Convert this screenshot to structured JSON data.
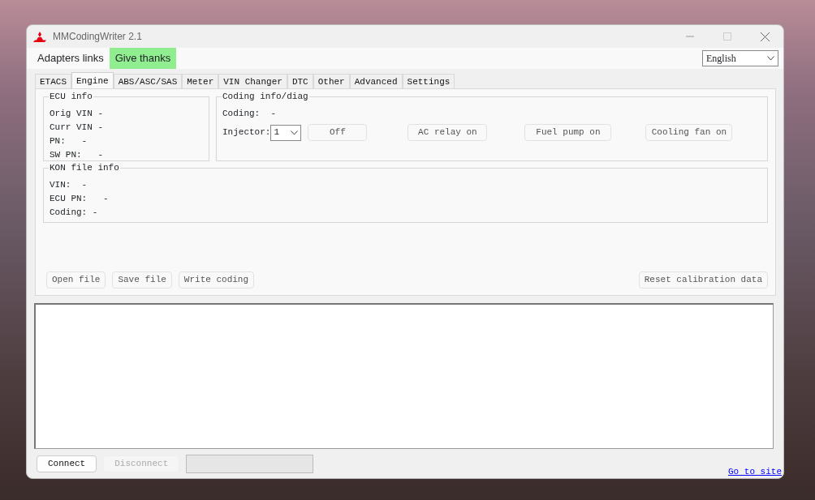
{
  "window": {
    "title": "MMCodingWriter 2.1"
  },
  "menu": [
    {
      "label": "Adapters links",
      "kind": "plain"
    },
    {
      "label": "Give thanks",
      "kind": "highlight"
    }
  ],
  "language": {
    "value": "English"
  },
  "tabs": [
    {
      "label": "ETACS",
      "selected": false
    },
    {
      "label": "Engine",
      "selected": true
    },
    {
      "label": "ABS/ASC/SAS",
      "selected": false
    },
    {
      "label": "Meter",
      "selected": false
    },
    {
      "label": "VIN Changer",
      "selected": false
    },
    {
      "label": "DTC",
      "selected": false
    },
    {
      "label": "Other",
      "selected": false
    },
    {
      "label": "Advanced",
      "selected": false
    },
    {
      "label": "Settings",
      "selected": false
    }
  ],
  "ecu_info": {
    "title": "ECU info",
    "fields": [
      "Orig VIN -",
      "Curr VIN -",
      "PN:   -",
      "SW PN:   -"
    ]
  },
  "coding_diag": {
    "title": "Coding info/diag",
    "coding": "Coding:  -",
    "injector": {
      "label": "Injector:",
      "value": "1"
    },
    "buttons": [
      {
        "label": "Off",
        "disabled": false
      },
      {
        "label": "AC relay on",
        "disabled": false
      },
      {
        "label": "Fuel pump on",
        "disabled": false
      },
      {
        "label": "Cooling fan on",
        "disabled": false
      }
    ]
  },
  "kon_file_info": {
    "title": "KON file info",
    "fields": [
      "VIN:  -",
      "ECU PN:   -",
      "Coding: -"
    ]
  },
  "file_buttons": [
    {
      "label": "Open file",
      "disabled": false
    },
    {
      "label": "Save file",
      "disabled": false
    },
    {
      "label": "Write coding",
      "disabled": false
    }
  ],
  "reset_button": {
    "label": "Reset calibration data",
    "disabled": false
  },
  "footer": {
    "buttons": [
      {
        "label": "Connect",
        "disabled": false
      },
      {
        "label": "Disconnect",
        "disabled": true
      }
    ],
    "progress": {
      "level": 0
    },
    "link": "Go to site"
  }
}
